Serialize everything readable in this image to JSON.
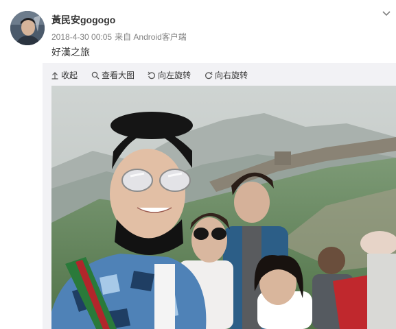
{
  "post": {
    "username": "黃民安gogogo",
    "timestamp": "2018-4-30 00:05",
    "source": "来自 Android客户端",
    "caption": "好漢之旅"
  },
  "toolbar": {
    "collapse_label": "收起",
    "view_large_label": "查看大图",
    "rotate_left_label": "向左旋转",
    "rotate_right_label": "向右旋转"
  },
  "icons": {
    "expand": "chevron-down-icon",
    "collapse": "arrow-up-icon",
    "zoom": "magnifier-icon",
    "rotate_left": "rotate-left-icon",
    "rotate_right": "rotate-right-icon"
  },
  "colors": {
    "username": "#333333",
    "meta": "#808080",
    "toolbar_bg": "#f2f2f5"
  }
}
